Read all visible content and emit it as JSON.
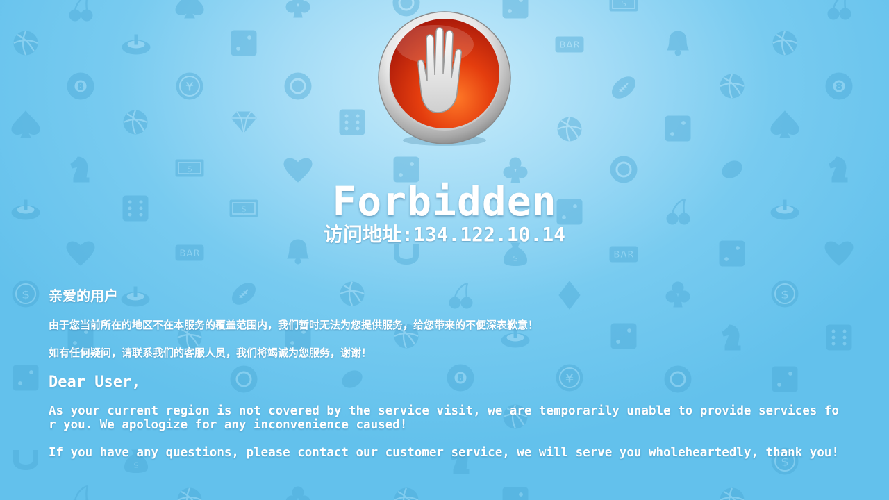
{
  "page": {
    "title": "Forbidden",
    "ip_line": "访问地址:134.122.10.14"
  },
  "message": {
    "cn_greeting": "亲爱的用户",
    "cn_line1": "由于您当前所在的地区不在本服务的覆盖范围内，我们暂时无法为您提供服务，给您带来的不便深表歉意！",
    "cn_line2": "如有任何疑问，请联系我们的客服人员，我们将竭诚为您服务，谢谢！",
    "en_greeting": "Dear User,",
    "en_line1": "As your current region is not covered by the service visit, we are temporarily unable to provide services for you. We apologize for any inconvenience caused!",
    "en_line2": "If you have any questions, please contact our customer service, we will serve you wholeheartedly, thank you!"
  },
  "background": {
    "pattern_icons": [
      "volleyball-icon",
      "roulette-icon",
      "dice-icon",
      "slot-machine-icon",
      "bar-icon",
      "bell-icon",
      "eight-ball-icon",
      "yen-coin-icon",
      "poker-chip-icon",
      "football-icon",
      "soccer-ball-icon",
      "spade-icon",
      "tennis-ball-icon",
      "diamond-gem-icon",
      "bingo-card-icon",
      "basketball-icon",
      "chess-knight-icon",
      "cash-icon",
      "strawberry-icon",
      "club-icon",
      "bowling-icon",
      "lemon-icon",
      "cherry-icon",
      "heart-icon",
      "horseshoe-icon",
      "money-bag-icon",
      "777-icon",
      "dollar-coin-icon",
      "clover-icon"
    ],
    "accent_color": "#63c1ec",
    "icon_color": "#3d98c4"
  },
  "stop_sign": {
    "icon": "hand-stop-icon",
    "color": "#d8300e"
  }
}
